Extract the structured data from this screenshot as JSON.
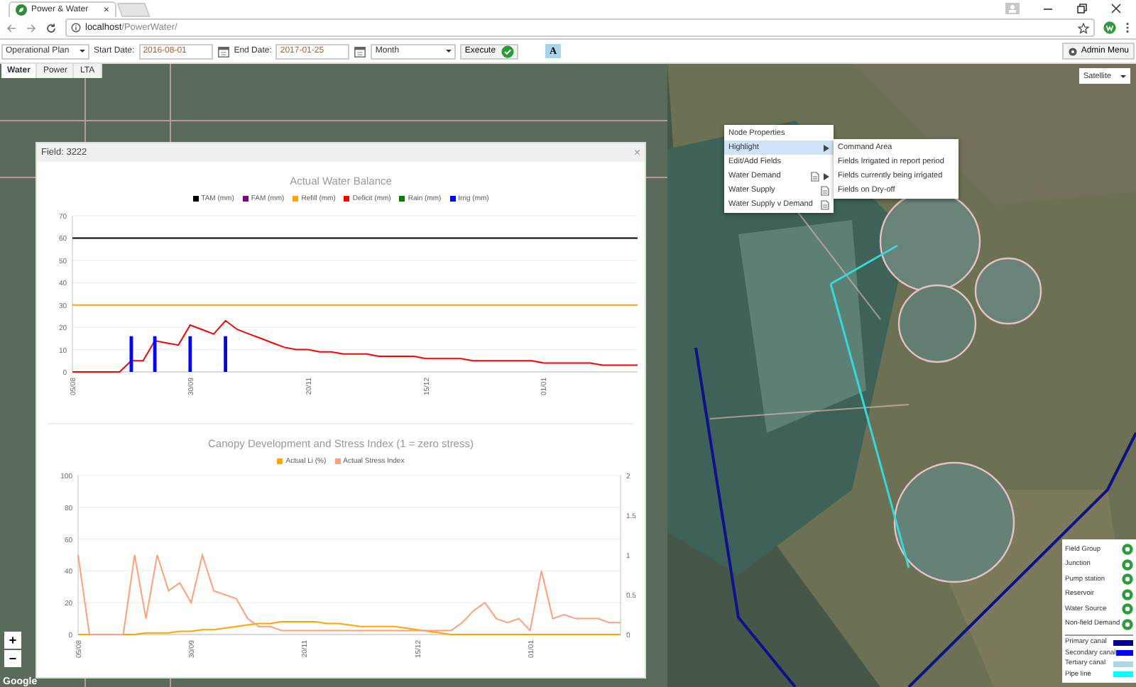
{
  "browser": {
    "tab_title": "Power & Water",
    "tab_close": "×",
    "address_host": "localhost",
    "address_path": "/PowerWater/"
  },
  "toolbar": {
    "plan": "Operational Plan",
    "start_label": "Start Date:",
    "start_date": "2016-08-01",
    "end_label": "End Date:",
    "end_date": "2017-01-25",
    "period": "Month",
    "execute": "Execute",
    "font_button": "A",
    "admin": "Admin Menu"
  },
  "map": {
    "kind": "picture",
    "tabs": [
      {
        "label": "Water",
        "selected": true
      },
      {
        "label": "Power",
        "selected": false
      },
      {
        "label": "LTA",
        "selected": false
      }
    ],
    "layer": "Satellite",
    "zoom_in": "+",
    "zoom_out": "−",
    "provider": "Google"
  },
  "dialog": {
    "title": "Field: 3222",
    "close": "×",
    "water_balance": {
      "chart_data": {
        "type": "line",
        "title": "Actual Water Balance",
        "legend": "top",
        "grid": true,
        "categories": [
          "05/08",
          null,
          null,
          null,
          null,
          null,
          null,
          null,
          null,
          null,
          "30/09",
          null,
          null,
          null,
          null,
          null,
          null,
          null,
          null,
          null,
          "20/11",
          null,
          null,
          null,
          null,
          null,
          null,
          null,
          null,
          null,
          "15/12",
          null,
          null,
          null,
          null,
          null,
          null,
          null,
          null,
          null,
          "01/01",
          null,
          null,
          null,
          null,
          null,
          null,
          null,
          null
        ],
        "ylim": [
          0,
          70
        ],
        "yticks": [
          0,
          10,
          20,
          30,
          40,
          50,
          60,
          70
        ],
        "series": [
          {
            "name": "TAM (mm)",
            "color": "#000000",
            "values": [
              60,
              60,
              60,
              60,
              60,
              60,
              60,
              60,
              60,
              60,
              60,
              60,
              60,
              60,
              60,
              60,
              60,
              60,
              60,
              60,
              60,
              60,
              60,
              60,
              60,
              60,
              60,
              60,
              60,
              60,
              60,
              60,
              60,
              60,
              60,
              60,
              60,
              60,
              60,
              60,
              60,
              60,
              60,
              60,
              60,
              60,
              60,
              60,
              60
            ]
          },
          {
            "name": "FAM (mm)",
            "color": "#800080",
            "values": [
              null,
              null,
              null,
              null,
              null,
              null,
              null,
              null,
              null,
              null,
              null,
              null,
              null,
              null,
              null,
              null,
              null,
              null,
              null,
              null,
              null,
              null,
              null,
              null,
              null,
              null,
              null,
              null,
              null,
              null,
              null,
              null,
              null,
              null,
              null,
              null,
              null,
              null,
              null,
              null,
              null,
              null,
              null,
              null,
              null,
              null,
              null,
              null,
              null
            ]
          },
          {
            "name": "Refill (mm)",
            "color": "#ffa500",
            "values": [
              30,
              30,
              30,
              30,
              30,
              30,
              30,
              30,
              30,
              30,
              30,
              30,
              30,
              30,
              30,
              30,
              30,
              30,
              30,
              30,
              30,
              30,
              30,
              30,
              30,
              30,
              30,
              30,
              30,
              30,
              30,
              30,
              30,
              30,
              30,
              30,
              30,
              30,
              30,
              30,
              30,
              30,
              30,
              30,
              30,
              30,
              30,
              30,
              30
            ]
          },
          {
            "name": "Deficit (mm)",
            "color": "#ff0000",
            "values": [
              0,
              0,
              0,
              0,
              0,
              5,
              5,
              14,
              13,
              12,
              21,
              19,
              17,
              23,
              19,
              17,
              15,
              13,
              11,
              10,
              10,
              9,
              9,
              8,
              8,
              8,
              7,
              7,
              7,
              7,
              6,
              6,
              6,
              6,
              5,
              5,
              5,
              5,
              5,
              5,
              4,
              4,
              4,
              4,
              4,
              3,
              3,
              3,
              3
            ]
          },
          {
            "name": "Rain (mm)",
            "color": "#008000",
            "type": "bar",
            "values": [
              null,
              null,
              null,
              null,
              null,
              null,
              null,
              null,
              null,
              null,
              null,
              null,
              null,
              null,
              null,
              null,
              null,
              null,
              null,
              null,
              null,
              null,
              null,
              null,
              null,
              null,
              null,
              null,
              null,
              null,
              null,
              null,
              null,
              null,
              null,
              null,
              null,
              null,
              null,
              null,
              null,
              null,
              null,
              null,
              null,
              null,
              null,
              null,
              null
            ]
          },
          {
            "name": "Irrig (mm)",
            "color": "#0000ff",
            "type": "bar",
            "values": [
              null,
              null,
              null,
              null,
              null,
              16,
              null,
              16,
              null,
              null,
              16,
              null,
              null,
              16,
              null,
              null,
              null,
              null,
              null,
              null,
              null,
              null,
              null,
              null,
              null,
              null,
              null,
              null,
              null,
              null,
              null,
              null,
              null,
              null,
              null,
              null,
              null,
              null,
              null,
              null,
              null,
              null,
              null,
              null,
              null,
              null,
              null,
              null,
              null
            ]
          }
        ]
      }
    },
    "canopy": {
      "chart_data": {
        "type": "line",
        "title": "Canopy Development and Stress Index (1 = zero stress)",
        "legend": "top",
        "grid": true,
        "categories": [
          "05/08",
          null,
          null,
          null,
          null,
          null,
          null,
          null,
          null,
          null,
          "30/09",
          null,
          null,
          null,
          null,
          null,
          null,
          null,
          null,
          null,
          "20/11",
          null,
          null,
          null,
          null,
          null,
          null,
          null,
          null,
          null,
          "15/12",
          null,
          null,
          null,
          null,
          null,
          null,
          null,
          null,
          null,
          "01/01",
          null,
          null,
          null,
          null,
          null,
          null,
          null,
          null
        ],
        "ylim": [
          0,
          100
        ],
        "yticks": [
          0,
          20,
          40,
          60,
          80,
          100
        ],
        "y2lim": [
          0,
          2
        ],
        "y2ticks": [
          0,
          0.5,
          1,
          1.5,
          2
        ],
        "series": [
          {
            "name": "Actual Li (%)",
            "color": "#ffa500",
            "values": [
              0,
              0,
              0,
              0,
              0,
              0,
              1,
              1,
              1,
              2,
              2,
              3,
              3,
              4,
              5,
              6,
              7,
              7,
              8,
              8,
              8,
              8,
              7,
              7,
              6,
              5,
              5,
              5,
              5,
              4,
              3,
              2,
              1,
              0,
              0,
              0,
              0,
              0,
              0,
              0,
              0,
              0,
              0,
              0,
              0,
              0,
              0,
              0,
              0
            ]
          },
          {
            "name": "Actual Stress Index",
            "color": "#ffa07a",
            "axis": "y2",
            "values": [
              1,
              0,
              0,
              0,
              0,
              1,
              0.2,
              1,
              0.55,
              0.65,
              0.4,
              1,
              0.55,
              0.5,
              0.45,
              0.2,
              0.1,
              0.1,
              0.05,
              0.05,
              0.05,
              0.05,
              0.05,
              0.05,
              0.05,
              0.05,
              0.05,
              0.05,
              0.05,
              0.05,
              0.05,
              0.05,
              0.05,
              0.05,
              0.15,
              0.3,
              0.4,
              0.2,
              0.15,
              0.2,
              0.05,
              0.8,
              0.2,
              0.25,
              0.2,
              0.2,
              0.2,
              0.15,
              0.15
            ]
          }
        ]
      }
    }
  },
  "context_menu": {
    "items": [
      {
        "label": "Node Properties",
        "selected": false,
        "submenu": false,
        "report": false
      },
      {
        "label": "Highlight",
        "selected": true,
        "submenu": true,
        "report": false
      },
      {
        "label": "Edit/Add Fields",
        "selected": false,
        "submenu": false,
        "report": false
      },
      {
        "label": "Water Demand",
        "selected": false,
        "submenu": true,
        "report": true
      },
      {
        "label": "Water Supply",
        "selected": false,
        "submenu": false,
        "report": true
      },
      {
        "label": "Water Supply v Demand",
        "selected": false,
        "submenu": false,
        "report": true
      }
    ]
  },
  "submenu": {
    "items": [
      {
        "label": "Command Area"
      },
      {
        "label": "Fields Irrigated in report period"
      },
      {
        "label": "Fields currently being irrigated"
      },
      {
        "label": "Fields on Dry-off"
      }
    ]
  },
  "legend": {
    "items": [
      {
        "kind": "node",
        "label": "Field Group"
      },
      {
        "kind": "node",
        "label": "Junction"
      },
      {
        "kind": "node",
        "label": "Pump station"
      },
      {
        "kind": "node",
        "label": "Reservoir"
      },
      {
        "kind": "node",
        "label": "Water Source"
      },
      {
        "kind": "node",
        "label": "Non-field Demand"
      },
      {
        "kind": "line",
        "label": "Primary canal",
        "color": "#00008b"
      },
      {
        "kind": "line",
        "label": "Secondary canal",
        "color": "#0000ff"
      },
      {
        "kind": "line",
        "label": "Tertiary canal",
        "color": "#add8e6"
      },
      {
        "kind": "line",
        "label": "Pipe line",
        "color": "#00ffff"
      }
    ]
  }
}
